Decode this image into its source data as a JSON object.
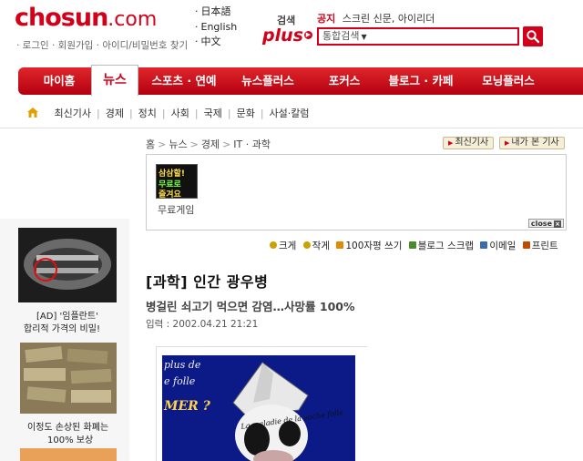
{
  "header": {
    "logo_main": "chosun",
    "logo_domain": ".com",
    "login_links": "· 로그인 · 회원가입 · 아이디/비밀번호 찾기",
    "languages": [
      "日本語",
      "English",
      "中文"
    ],
    "search_plus_top": "검색",
    "search_plus_bottom": "plus",
    "notice_label": "공지",
    "notice_text": "스크린 신문, 아이리더",
    "search_placeholder": "통합검색",
    "brand_color": "#d4001a"
  },
  "nav": {
    "items": [
      "마이홈",
      "뉴스",
      "스포츠 · 연예",
      "뉴스플러스",
      "포커스",
      "블로그 · 카페",
      "모닝플러스"
    ],
    "active_index": 1
  },
  "subnav": {
    "items": [
      "최신기사",
      "경제",
      "정치",
      "사회",
      "국제",
      "문화",
      "사설·칼럼"
    ]
  },
  "breadcrumb": {
    "items": [
      "홈",
      "뉴스",
      "경제",
      "IT · 과학"
    ],
    "latest_button": "최신기사",
    "viewed_button": "내가 본 기사"
  },
  "ad": {
    "game_line1": "삼삼할!",
    "game_line2": "무료로",
    "game_line3": "즐겨요",
    "game_label": "무료게임",
    "close_label": "close"
  },
  "tools": {
    "items": [
      {
        "label": "크게",
        "icon": "plus-circle-icon",
        "color": "#c9a200"
      },
      {
        "label": "작게",
        "icon": "minus-circle-icon",
        "color": "#c9a200"
      },
      {
        "label": "100자평 쓰기",
        "icon": "comment-icon",
        "color": "#e08a00"
      },
      {
        "label": "블로그 스크랩",
        "icon": "blog-icon",
        "color": "#4a8a2a"
      },
      {
        "label": "이메일",
        "icon": "email-icon",
        "color": "#3a6ab0"
      },
      {
        "label": "프린트",
        "icon": "print-icon",
        "color": "#c24a00"
      }
    ]
  },
  "article": {
    "title": "[과학] 인간 광우병",
    "subtitle": "병걸린 쇠고기 먹으면 감염…사망률 100%",
    "date": "입력 : 2002.04.21 21:21",
    "photo_text1": "plus de",
    "photo_text2": "e folle",
    "photo_text3": "MER ?",
    "photo_text4": "La maladie de la vache folle"
  },
  "left_ads": [
    {
      "line1": "[AD] '임플란트'",
      "line2": "합리적 가격의 비밀!"
    },
    {
      "line1": "이정도 손상된 화폐는",
      "line2": "100% 보상"
    }
  ]
}
